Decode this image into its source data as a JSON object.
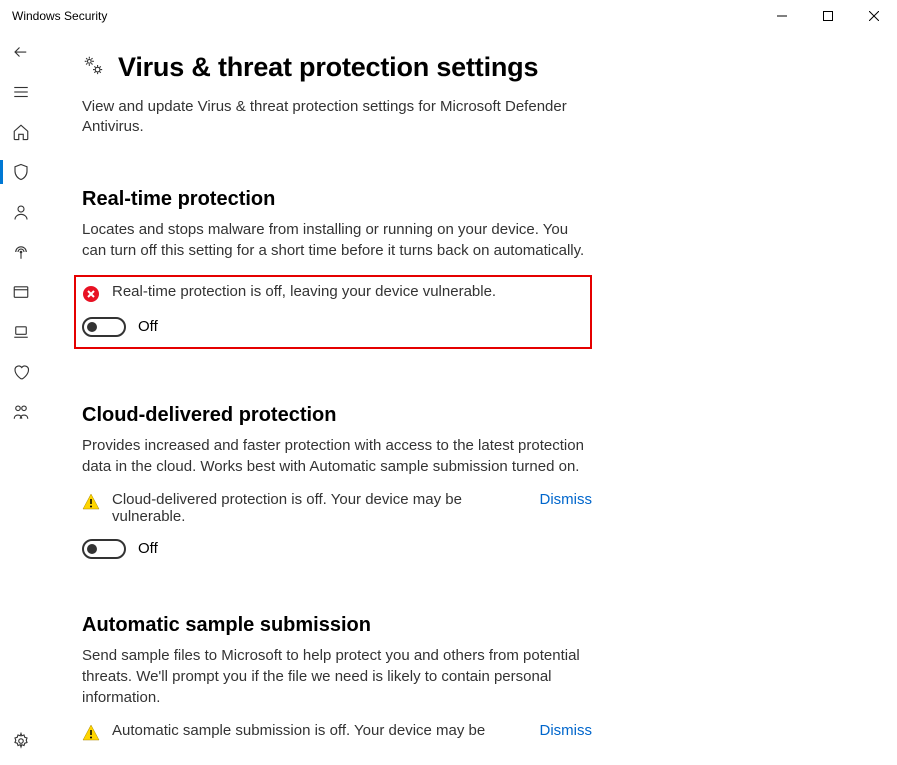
{
  "window": {
    "title": "Windows Security"
  },
  "page": {
    "title": "Virus & threat protection settings",
    "subtitle": "View and update Virus & threat protection settings for Microsoft Defender Antivirus."
  },
  "sections": {
    "realtime": {
      "title": "Real-time protection",
      "desc": "Locates and stops malware from installing or running on your device. You can turn off this setting for a short time before it turns back on automatically.",
      "alert": "Real-time protection is off, leaving your device vulnerable.",
      "toggle_state": "Off"
    },
    "cloud": {
      "title": "Cloud-delivered protection",
      "desc": "Provides increased and faster protection with access to the latest protection data in the cloud. Works best with Automatic sample submission turned on.",
      "alert": "Cloud-delivered protection is off. Your device may be vulnerable.",
      "dismiss": "Dismiss",
      "toggle_state": "Off"
    },
    "sample": {
      "title": "Automatic sample submission",
      "desc": "Send sample files to Microsoft to help protect you and others from potential threats. We'll prompt you if the file we need is likely to contain personal information.",
      "alert": "Automatic sample submission is off. Your device may be",
      "dismiss": "Dismiss"
    }
  }
}
